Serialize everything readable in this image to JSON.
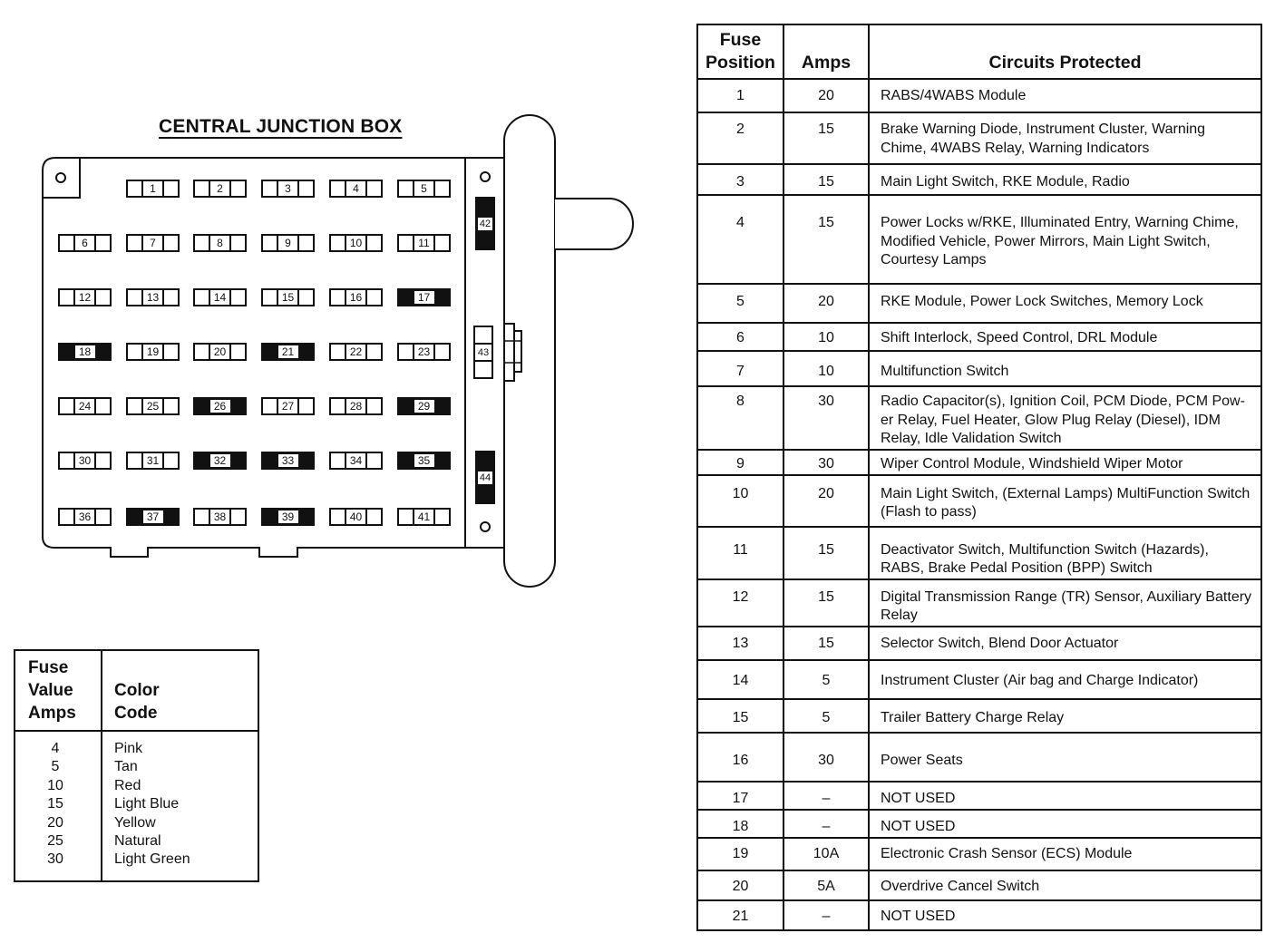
{
  "diagram": {
    "title": "CENTRAL JUNCTION BOX",
    "fuses_main": [
      [
        "1",
        "2",
        "3",
        "4",
        "5"
      ],
      [
        "6",
        "7",
        "8",
        "9",
        "10",
        "11"
      ],
      [
        "12",
        "13",
        "14",
        "15",
        "16",
        "17"
      ],
      [
        "18",
        "19",
        "20",
        "21",
        "22",
        "23"
      ],
      [
        "24",
        "25",
        "26",
        "27",
        "28",
        "29"
      ],
      [
        "30",
        "31",
        "32",
        "33",
        "34",
        "35"
      ],
      [
        "36",
        "37",
        "38",
        "39",
        "40",
        "41"
      ]
    ],
    "relay_positions": [
      "17",
      "18",
      "21",
      "26",
      "29",
      "32",
      "33",
      "35",
      "37",
      "39"
    ],
    "side_fuses": [
      {
        "label": "42",
        "relay": true
      },
      {
        "label": "43",
        "relay": false
      },
      {
        "label": "44",
        "relay": true
      }
    ]
  },
  "color_code_table": {
    "header_amps": [
      "Fuse",
      "Value",
      "Amps"
    ],
    "header_color": [
      "Color",
      "Code"
    ],
    "rows": [
      {
        "amps": "4",
        "color": "Pink"
      },
      {
        "amps": "5",
        "color": "Tan"
      },
      {
        "amps": "10",
        "color": "Red"
      },
      {
        "amps": "15",
        "color": "Light Blue"
      },
      {
        "amps": "20",
        "color": "Yellow"
      },
      {
        "amps": "25",
        "color": "Natural"
      },
      {
        "amps": "30",
        "color": "Light Green"
      }
    ]
  },
  "fuse_table": {
    "headers": {
      "position": [
        "Fuse",
        "Position"
      ],
      "amps": "Amps",
      "circuits": "Circuits Protected"
    },
    "rows": [
      {
        "pos": "1",
        "amps": "20",
        "circuits": "RABS/4WABS  Module"
      },
      {
        "pos": "2",
        "amps": "15",
        "circuits": "Brake Warning Diode, Instrument Cluster, Warning Chime, 4WABS Relay, Warning Indicators"
      },
      {
        "pos": "3",
        "amps": "15",
        "circuits": "Main Light Switch, RKE Module, Radio"
      },
      {
        "pos": "4",
        "amps": "15",
        "circuits": "Power Locks w/RKE, Illuminated Entry, Warning Chime, Modified Vehicle, Power Mirrors, Main Light Switch, Courtesy Lamps"
      },
      {
        "pos": "5",
        "amps": "20",
        "circuits": "RKE Module, Power Lock Switches, Memory Lock"
      },
      {
        "pos": "6",
        "amps": "10",
        "circuits": "Shift Interlock, Speed Control, DRL Module"
      },
      {
        "pos": "7",
        "amps": "10",
        "circuits": "Multifunction Switch"
      },
      {
        "pos": "8",
        "amps": "30",
        "circuits": "Radio Capacitor(s), Ignition Coil, PCM Diode, PCM Pow- er Relay,  Fuel Heater, Glow Plug Relay (Diesel), IDM Relay, Idle Validation Switch"
      },
      {
        "pos": "9",
        "amps": "30",
        "circuits": "Wiper Control Module, Windshield Wiper Motor"
      },
      {
        "pos": "10",
        "amps": "20",
        "circuits": "Main Light Switch,  (External Lamps) MultiFunction Switch (Flash to pass)"
      },
      {
        "pos": "11",
        "amps": "15",
        "circuits": "Deactivator Switch, Multifunction Switch (Hazards), RABS, Brake Pedal Position (BPP) Switch"
      },
      {
        "pos": "12",
        "amps": "15",
        "circuits": "Digital Transmission Range (TR) Sensor, Auxiliary Battery Relay"
      },
      {
        "pos": "13",
        "amps": "15",
        "circuits": "Selector Switch, Blend Door Actuator"
      },
      {
        "pos": "14",
        "amps": "5",
        "circuits": "Instrument Cluster (Air bag and Charge Indicator)"
      },
      {
        "pos": "15",
        "amps": "5",
        "circuits": "Trailer Battery Charge Relay"
      },
      {
        "pos": "16",
        "amps": "30",
        "circuits": "Power  Seats"
      },
      {
        "pos": "17",
        "amps": "–",
        "circuits": "NOT USED"
      },
      {
        "pos": "18",
        "amps": "–",
        "circuits": "NOT USED"
      },
      {
        "pos": "19",
        "amps": "10A",
        "circuits": "Electronic Crash Sensor (ECS) Module"
      },
      {
        "pos": "20",
        "amps": "5A",
        "circuits": "Overdrive Cancel Switch"
      },
      {
        "pos": "21",
        "amps": "–",
        "circuits": "NOT USED"
      }
    ]
  }
}
